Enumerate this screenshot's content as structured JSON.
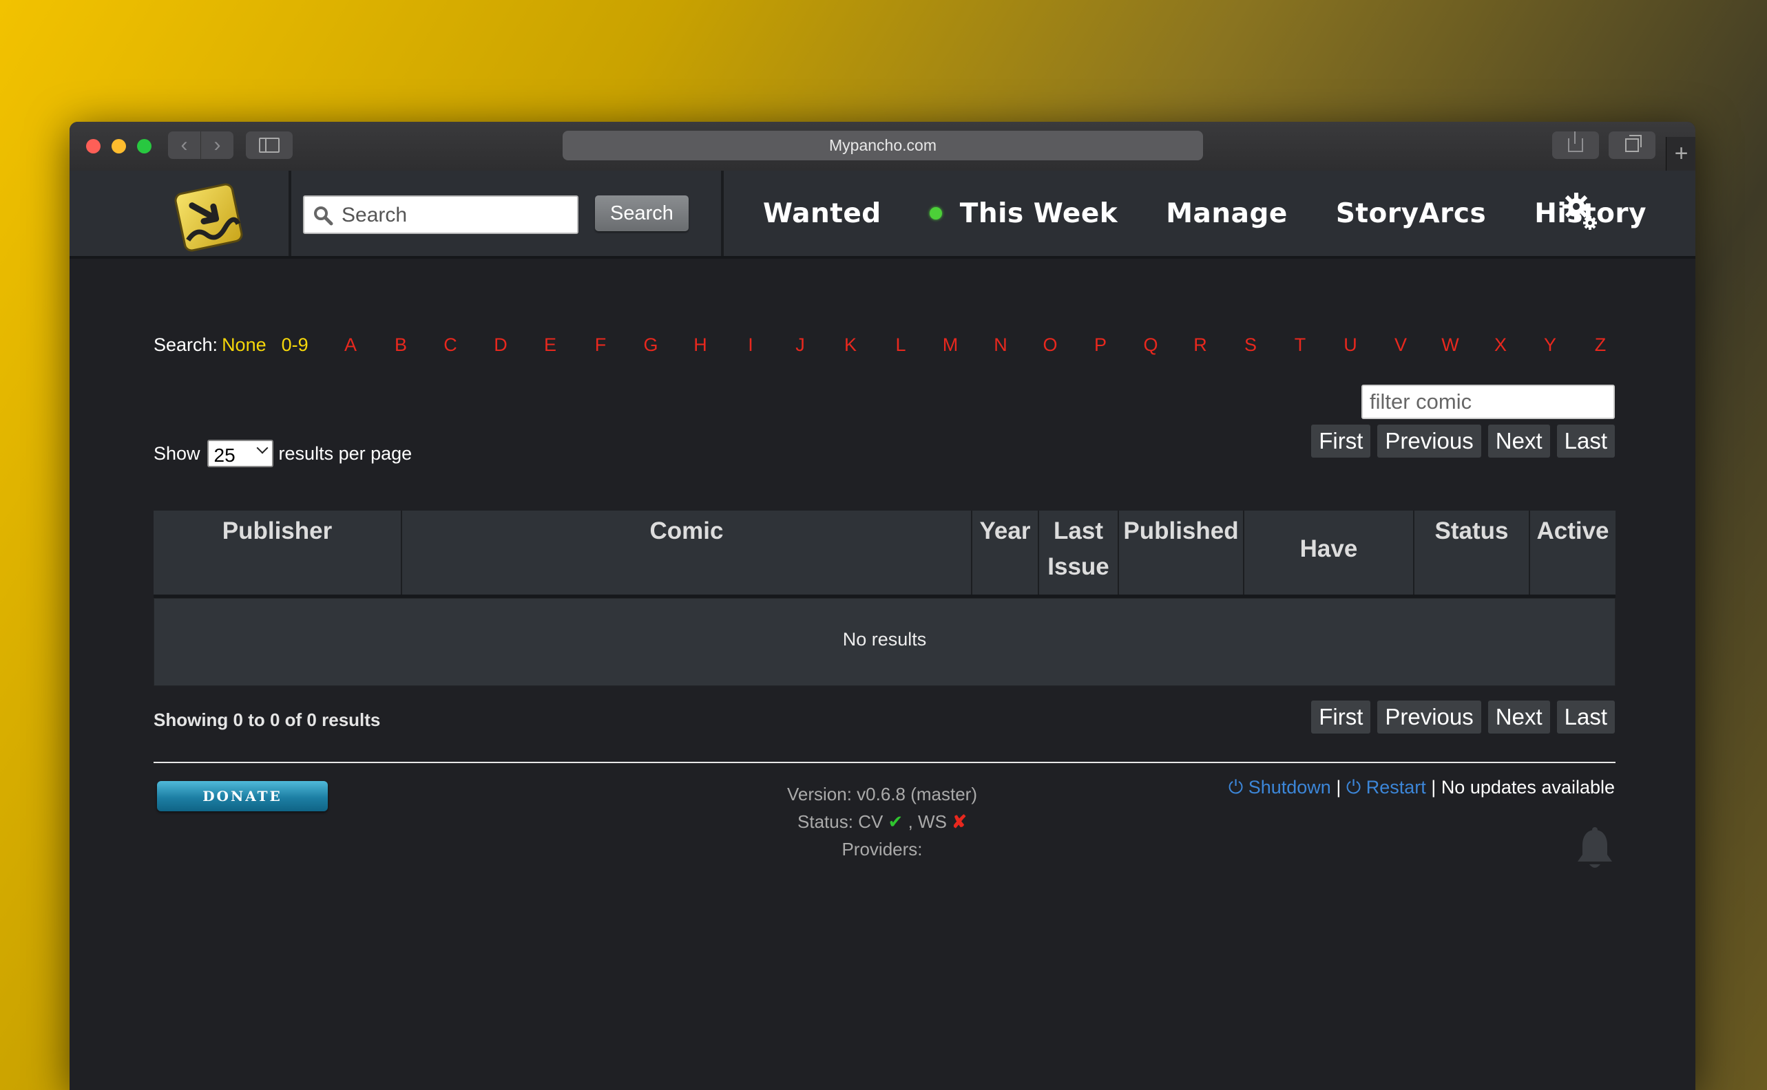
{
  "browser": {
    "url": "Mypancho.com",
    "new_tab": "+"
  },
  "header": {
    "search_placeholder": "Search",
    "search_button": "Search",
    "nav": {
      "wanted": "Wanted",
      "this_week": "This Week",
      "manage": "Manage",
      "storyarcs": "StoryArcs",
      "history": "History"
    }
  },
  "alpha_search": {
    "label": "Search:",
    "selected": "None",
    "numeric": "0-9",
    "letters": [
      "A",
      "B",
      "C",
      "D",
      "E",
      "F",
      "G",
      "H",
      "I",
      "J",
      "K",
      "L",
      "M",
      "N",
      "O",
      "P",
      "Q",
      "R",
      "S",
      "T",
      "U",
      "V",
      "W",
      "X",
      "Y",
      "Z"
    ]
  },
  "filter": {
    "placeholder": "filter comic"
  },
  "length": {
    "prefix": "Show",
    "value": "25",
    "suffix": "results per page"
  },
  "pagination": {
    "first": "First",
    "previous": "Previous",
    "next": "Next",
    "last": "Last"
  },
  "table": {
    "headers": {
      "publisher": "Publisher",
      "comic": "Comic",
      "year": "Year",
      "last_issue_1": "Last",
      "last_issue_2": "Issue",
      "published": "Published",
      "have": "Have",
      "status": "Status",
      "active": "Active"
    },
    "empty": "No results"
  },
  "info": "Showing 0 to 0 of 0 results",
  "footer": {
    "donate": "DONATE",
    "version": "Version: v0.6.8 (master)",
    "status_prefix": "Status: CV",
    "status_ok": "✔",
    "status_mid": ", WS",
    "status_bad": "✘",
    "providers": "Providers:",
    "shutdown": "Shutdown",
    "restart": "Restart",
    "separator": "|",
    "updates": "No updates available"
  },
  "colors": {
    "accent_yellow": "#f6d70a",
    "letter_red": "#e8281e",
    "link_blue": "#3c86d8",
    "status_dot_green": "#4cd038"
  }
}
